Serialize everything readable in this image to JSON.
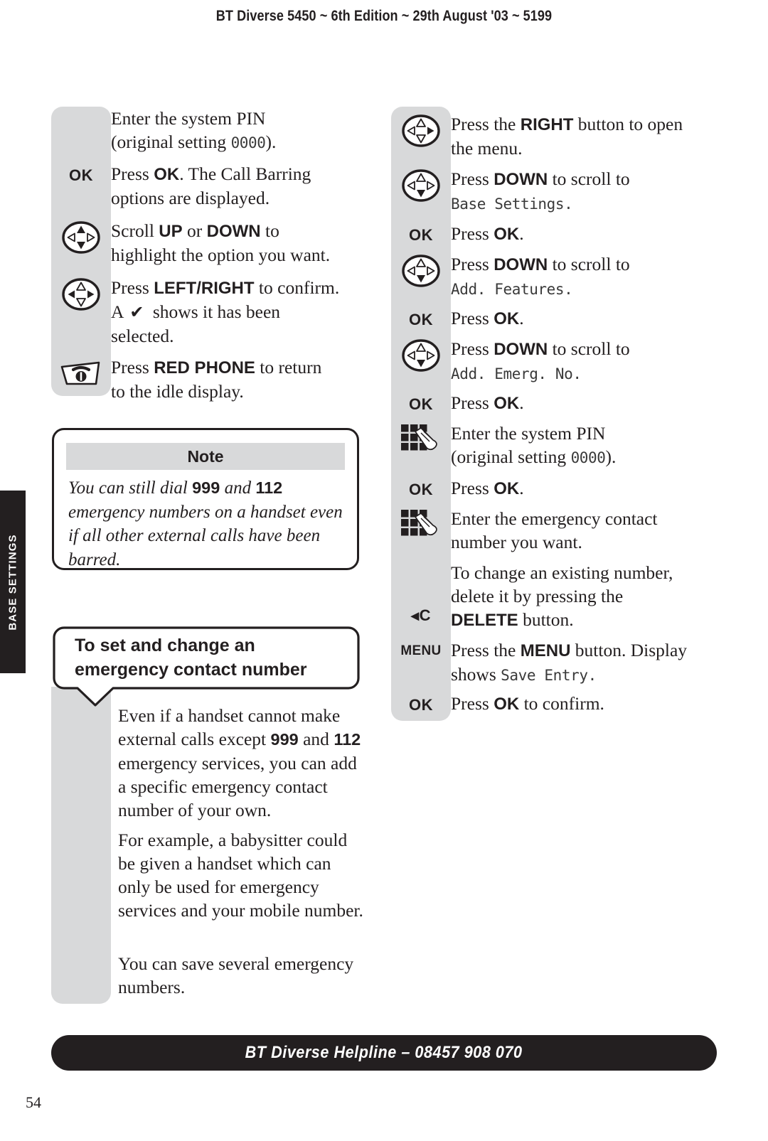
{
  "header": {
    "title": "BT Diverse 5450 ~ 6th Edition ~ 29th August '03 ~ 5199"
  },
  "side_tab": {
    "label": "BASE SETTINGS"
  },
  "left_column": {
    "steps": [
      {
        "icon": "none",
        "text_lines": [
          "Enter the system PIN",
          "(original setting 0000)."
        ],
        "lcd": "0000"
      },
      {
        "icon": "ok-key",
        "icon_label": "OK",
        "text_lines": [
          "Press OK. The Call Barring",
          "options are displayed."
        ]
      },
      {
        "icon": "nav-updown-key",
        "text_lines": [
          "Scroll UP or DOWN to",
          "highlight the option you want."
        ]
      },
      {
        "icon": "nav-leftright-key",
        "text_lines": [
          "Press LEFT/RIGHT to confirm.",
          "A ✔ shows it has been",
          "selected."
        ]
      },
      {
        "icon": "red-phone-key",
        "text_lines": [
          "Press RED PHONE to return",
          "to the idle display."
        ]
      }
    ]
  },
  "note_box": {
    "heading": "Note",
    "body": "You can still dial 999 and 112 emergency numbers on a handset even if all other external calls have been barred.",
    "bold_terms": [
      "999",
      "112"
    ]
  },
  "callout": {
    "heading_line1": "To set and change an",
    "heading_line2": "emergency contact number"
  },
  "lower_left_paragraphs": [
    "Even if a handset cannot make external calls except 999 and 112 emergency services, you can add a specific emergency contact number of your own.",
    "For example, a babysitter could be given a handset which can only be used for emergency services and your mobile number.",
    "You can save several emergency numbers."
  ],
  "right_column": {
    "steps": [
      {
        "icon": "nav-right-key",
        "text_lines": [
          "Press the RIGHT button to open",
          "the menu."
        ]
      },
      {
        "icon": "nav-down-key",
        "text_lines": [
          "Press DOWN to scroll to",
          "Base Settings."
        ],
        "lcd": "Base Settings."
      },
      {
        "icon": "ok-key",
        "icon_label": "OK",
        "text_lines": [
          "Press OK."
        ]
      },
      {
        "icon": "nav-down-key",
        "text_lines": [
          "Press DOWN to scroll to",
          "Add. Features."
        ],
        "lcd": "Add. Features."
      },
      {
        "icon": "ok-key",
        "icon_label": "OK",
        "text_lines": [
          "Press OK."
        ]
      },
      {
        "icon": "nav-down-key",
        "text_lines": [
          "Press DOWN to scroll to",
          "Add. Emerg. No."
        ],
        "lcd": "Add. Emerg. No."
      },
      {
        "icon": "ok-key",
        "icon_label": "OK",
        "text_lines": [
          "Press OK."
        ]
      },
      {
        "icon": "keypad-key",
        "text_lines": [
          "Enter the system PIN",
          "(original setting 0000)."
        ],
        "lcd": "0000"
      },
      {
        "icon": "ok-key",
        "icon_label": "OK",
        "text_lines": [
          "Press OK."
        ]
      },
      {
        "icon": "keypad-key",
        "text_lines": [
          "Enter the emergency contact",
          "number you want."
        ]
      },
      {
        "icon": "delete-key",
        "icon_label": "◂C",
        "text_lines": [
          "To change an existing number,",
          "delete it by pressing the",
          "DELETE button."
        ]
      },
      {
        "icon": "menu-key",
        "icon_label": "MENU",
        "text_lines": [
          "Press the MENU button. Display",
          "shows Save Entry."
        ],
        "lcd": "Save Entry."
      },
      {
        "icon": "ok-key",
        "icon_label": "OK",
        "text_lines": [
          "Press OK to confirm."
        ]
      }
    ]
  },
  "footer": {
    "helpline": "BT Diverse Helpline – 08457 908 070",
    "page_number": "54"
  },
  "colors": {
    "ink": "#231f20",
    "grey_panel": "#d8d9da",
    "paper": "#ffffff"
  }
}
